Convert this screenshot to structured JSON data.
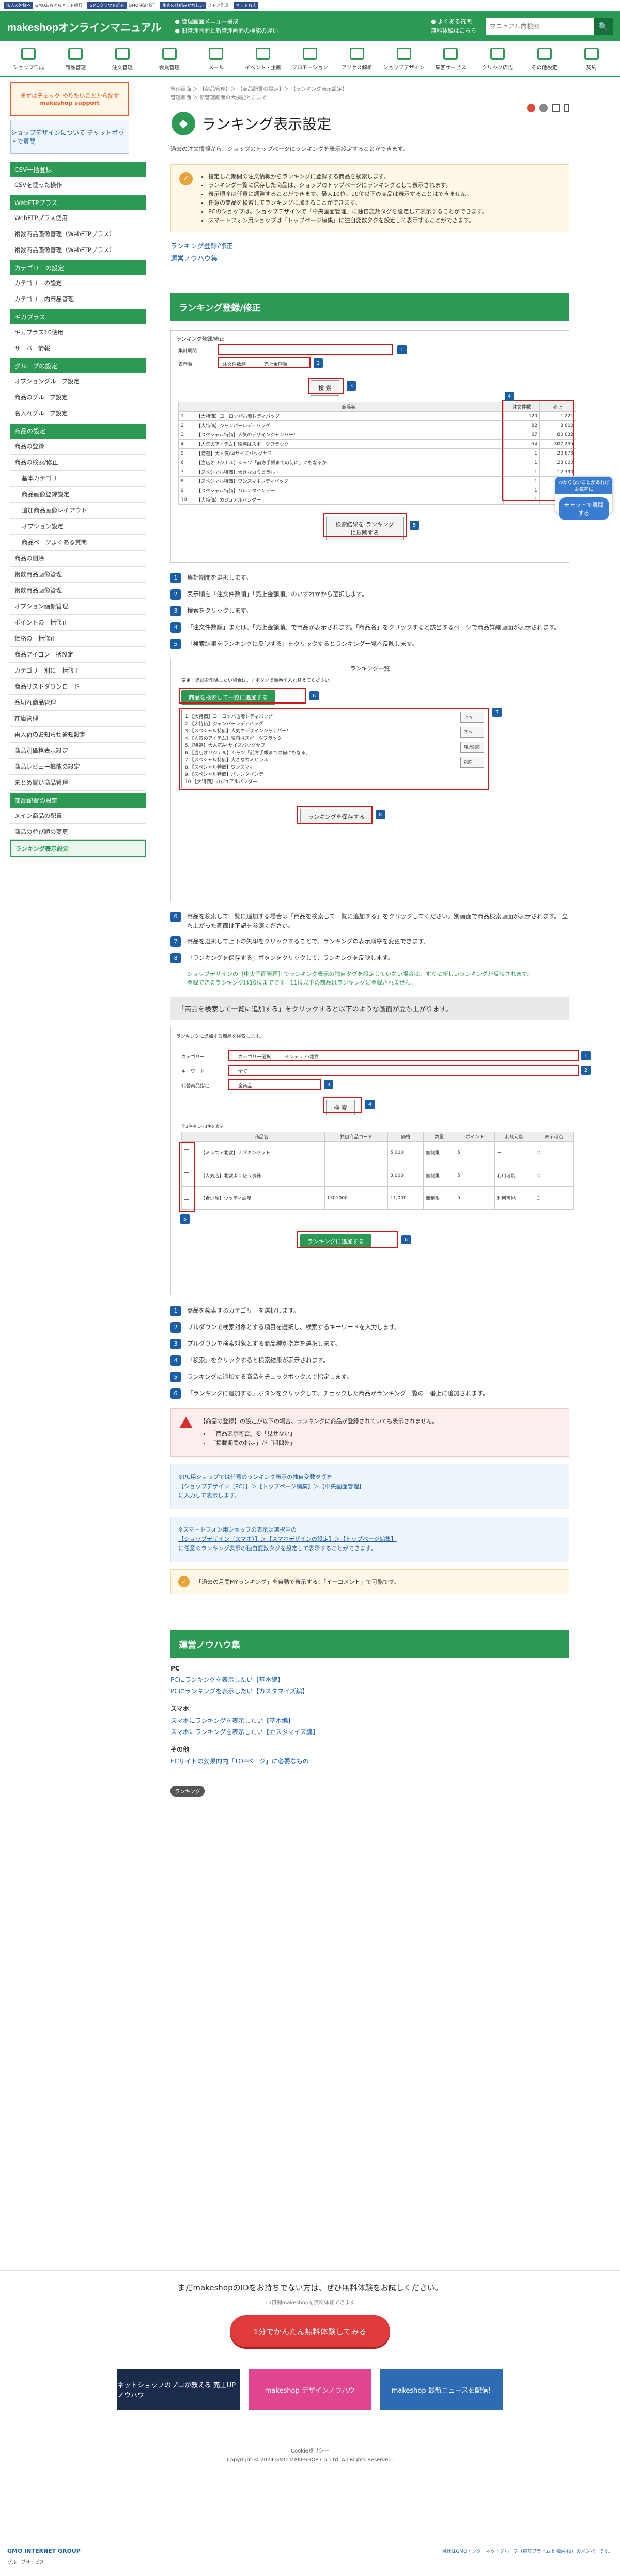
{
  "topbar": {
    "items": [
      "法人の皆様へ",
      "GMOあおぞらネット銀行",
      "GMOクラウド証券",
      "GMO決済代行",
      "集客の仕組みが欲しい",
      "ストア作成",
      "ネットお店"
    ],
    "cue": "ログイン"
  },
  "header": {
    "logo": "makeshopオンラインマニュアル",
    "link1": "● 管理画面メニュー構成",
    "link2": "● 旧管理画面と新管理画面の機能の違い",
    "right1": "● よくある質問",
    "right2": "無料体験はこちら",
    "search_placeholder": "マニュアル内検索",
    "search_icon": "🔍"
  },
  "nav": {
    "items": [
      "ショップ作成",
      "商品管理",
      "注文管理",
      "会員管理",
      "メール",
      "イベント・企画",
      "プロモーション",
      "アクセス解析",
      "ショップデザイン",
      "集客サービス",
      "クリック広告",
      "その他設定",
      "契約"
    ]
  },
  "sidebar": {
    "banner1": "まずはチェック!やりたいことから探す",
    "banner1_sub": "makeshop support",
    "banner2": "ショップデザインについて チャットボットで質問",
    "sections": [
      {
        "title": "CSV一括登録",
        "items": [
          "CSVを使った操作"
        ]
      },
      {
        "title": "WebFTPプラス",
        "items": [
          "WebFTPプラス使用",
          "複数商品画像管理（WebFTPプラス）",
          "複数商品画像管理（WebFTPプラス）"
        ]
      },
      {
        "title": "カテゴリーの設定",
        "items": [
          "カテゴリーの設定",
          "カテゴリー内商品管理"
        ]
      },
      {
        "title": "ギガプラス",
        "items": [
          "ギガプラス10使用",
          "サーバー情報"
        ]
      },
      {
        "title": "グループの設定",
        "items": [
          "オプショングループ設定",
          "商品のグループ設定",
          "名入れグループ設定"
        ]
      },
      {
        "title": "商品の設定",
        "items": [
          "商品の登録",
          "商品の検索/修正",
          "基本カテゴリー",
          "商品画像登録設定",
          "追加商品画像レイアウト",
          "オプション設定",
          "商品ページよくある質問",
          "商品の削除",
          "複数商品画像管理",
          "複数商品画像管理",
          "オプション画像管理",
          "ポイントの一括修正",
          "価格の一括修正",
          "商品アイコン一括設定",
          "カテゴリー別に一括修正",
          "商品リストダウンロード",
          "品切れ商品管理",
          "在庫管理",
          "再入荷のお知らせ通知設定",
          "商品別価格表示設定",
          "商品レビュー機能の設定",
          "まとめ買い商品管理"
        ]
      },
      {
        "title": "商品配置の設定",
        "items": [
          "メイン商品の配置",
          "商品の並び順の変更",
          "ランキング表示設定"
        ]
      }
    ]
  },
  "content": {
    "breadcrumb1": "管理画面 ＞ 【商品管理】＞ 【商品配置の設定】＞ 【ランキング表示設定】",
    "breadcrumb2": "管理画面 ＞ 新管理画面の大機能とこまで",
    "title": "ランキング表示設定",
    "title_icon": "◆",
    "intro": "過去の注文情報から、ショップのトップページにランキングを表示設定することができます。",
    "notes": [
      "指定した期間の注文情報からランキングに登録する商品を検索します。",
      "ランキング一覧に保存した商品は、ショップのトップページにランキングとして表示されます。",
      "表示順序は任意に調整することができます。最大10位。10位以下の商品は表示することはできません。",
      "任意の商品を検索してランキングに加えることができます。",
      "PCのショップは、ショップデザインで「中央画面管理」に独自変数タグを設定して表示することができます。",
      "スマートフォン用ショップは「トップページ編集」に独自変数タグを設定して表示することができます。"
    ],
    "link1": "ランキング登録/修正",
    "link2": "運営ノウハウ集",
    "sec1": "ランキング登録/修正",
    "shot1_title": "ランキング登録/修正",
    "shot1_period_label": "集計期間",
    "shot1_display_label": "表示順",
    "shot1_opt1": "注文件数順",
    "shot1_opt2": "売上金額順",
    "shot1_search": "検 索",
    "shot1_col1": "商品名",
    "shot1_col2": "注文件数",
    "shot1_col3": "売上",
    "shot1_rows": [
      [
        "1",
        "【大特価】ヨーロッパ古着レディバッグ",
        "120",
        "1,221"
      ],
      [
        "2",
        "【大特価】ジャンパーレディバッグ",
        "82",
        "3,600"
      ],
      [
        "3",
        "【スペシャル特価】人気のデザインジャンパー！",
        "67",
        "80,832"
      ],
      [
        "4",
        "【人気のアイテム】映画はスポーツブラック",
        "54",
        "307,235"
      ],
      [
        "5",
        "【特選】大人気A4サイズバッグサブ",
        "1",
        "20,673"
      ],
      [
        "6",
        "【当店オリジナル】シャツ「前方手帳までの何に」にもなるか…",
        "1",
        "23,000"
      ],
      [
        "7",
        "【スペシャル特価】大きなカミビラル・",
        "1",
        "12,390"
      ],
      [
        "8",
        "【スペシャル特価】ワンスマホレディバッグ",
        "1",
        "9,900"
      ],
      [
        "9",
        "【スペシャル特価】バレンタインデー",
        "1",
        "4,900"
      ],
      [
        "10",
        "【大特価】カジュアルバンダー",
        "1",
        "1,350"
      ]
    ],
    "shot1_save": "検索結果を ランキングに反映する",
    "steps1": [
      "集計期間を選択します。",
      "表示順を「注文件数順」「売上金額順」のいずれかから選択します。",
      "検索をクリックします。",
      "「注文件数順」または、「売上金額順」で商品が表示されます。「商品名」をクリックすると該当するページで商品詳細画面が表示されます。",
      "「検索結果をランキングに反映する」をクリックするとランキング一覧へ反映します。"
    ],
    "shot2_title": "ランキング一覧",
    "shot2_desc": "変更・追加を削除したい場合は、☆ボタンで順番を入れ替えてください。",
    "shot2_add": "商品を検索して一覧に追加する",
    "shot2_list": [
      "1.【大特価】ヨーロッパ古着レディバッグ",
      "2.【大特価】ジャンパーレディバッグ",
      "3.【スペシャル特価】人気のデザインジャンパー！",
      "4.【人気のアイテム】映画はスポーツブラック",
      "5.【特選】大人気A4サイズバッグサブ",
      "6.【当店オリジナル】シャツ「前方手帳までの何にもなる」",
      "7.【スペシャル特価】大きなカミビラル",
      "8.【スペシャル特価】ワンスマホ",
      "9.【スペシャル特価】バレンタインデー",
      "10.【大特価】カジュアルバンダー"
    ],
    "shot2_save": "ランキングを保存する",
    "shot2_btns": [
      "上へ",
      "下へ",
      "選択削除",
      "削除"
    ],
    "steps2": [
      "「商品を検索して一覧に追加する」をクリックします。",
      "商品を選択して上下の矢印をクリックすることで、ランキングの表示順序を変更できます。",
      "「ランキングを保存する」ボタンをクリックして、ランキングを反映します。"
    ],
    "steps2_lead": "商品を検索して一覧に追加する場合は「商品を検索して一覧に追加する」をクリックしてください。別画面で商品検索画面が表示されます。 立ち上がった画面は下記を参照ください。",
    "note_green1": "ショップデザインの［中央画面管理］でランキング表示の独自タグを設定していない場合は、すぐに新しいランキングが反映されます。",
    "note_green2": "登録できるランキングは10位までです。11位以下の商品はランキングに登録されません。",
    "graybar": "「商品を検索して一覧に追加する」をクリックすると以下のような画面が立ち上がります。",
    "shot3_title": "ランキングに追加する商品を検索します。",
    "shot3_category": "カテゴリー",
    "shot3_cat1": "カテゴリー選択",
    "shot3_cat2": "インテリア/雑貨",
    "shot3_keyword": "キーワード",
    "shot3_kw_value": "全て",
    "shot3_status": "代替商品指定",
    "shot3_status_value": "全商品",
    "shot3_search": "検 索",
    "shot3_count": "全3件中 1～3件を表示",
    "shot3_cols": [
      "",
      "商品名",
      "独自商品コード",
      "価格",
      "数量",
      "ポイント",
      "利用可能",
      "表示可否"
    ],
    "shot3_rows": [
      [
        "",
        "【ミレニア北欧】ナプキンセット",
        "",
        "5,000",
        "無制限",
        "5",
        "ー",
        "○"
      ],
      [
        "",
        "【人気店】北欧よく使う食器",
        "",
        "3,000",
        "無制限",
        "5",
        "利用可能",
        "○"
      ],
      [
        "",
        "【希少品】ウッディ調度",
        "1301000",
        "11,000",
        "無制限",
        "5",
        "利用可能",
        "○"
      ]
    ],
    "shot3_add": "ランキングに追加する",
    "steps3": [
      "商品を検索するカテゴリーを選択します。",
      "プルダウンで検索対象とする項目を選択し、検索するキーワードを入力します。",
      "プルダウンで検索対象とする商品種別指定を選択します。",
      "「検索」をクリックすると検索結果が表示されます。",
      "ランキングに追加する商品をチェックボックスで指定します。",
      "「ランキングに追加する」ボタンをクリックして、チェックした商品がランキング一覧の一番上に追加されます。"
    ],
    "warn_head": "【商品の登録】の設定が以下の場合、ランキングに商品が登録されていても表示されません。",
    "warn_items": [
      "「商品表示可否」を「見せない」",
      "「掲載期間の指定」が「期間外」"
    ],
    "info1_line1": "※PC用ショップでは任意のランキング表示の独自変数タグを",
    "info1_line2": "【ショップデザイン（PC）】＞【トップページ編集】＞【中央画面管理】",
    "info1_line3": "に入力して表示します。",
    "info2_line1": "※スマートフォン用ショップの表示は選択中の",
    "info2_line2": "【ショップデザイン（スマホ）】＞【スマホデザインの設定】＞【トップページ編集】",
    "info2_line3": "に任意のランキング表示の独自変数タグを設定して表示することができます。",
    "tip": "「過去の月間MYランキング」を自動で表示する：「イーコメント」で可能です。",
    "sec2": "運営ノウハウ集",
    "kw_pc": "PC",
    "kw_pc_links": [
      "PCにランキングを表示したい【基本編】",
      "PCにランキングを表示したい【カスタマイズ編】"
    ],
    "kw_sp": "スマホ",
    "kw_sp_links": [
      "スマホにランキングを表示したい【基本編】",
      "スマホにランキングを表示したい【カスタマイズ編】"
    ],
    "kw_other": "その他",
    "kw_other_links": [
      "ECサイトの効果的内「TOPページ」に必要なもの"
    ],
    "tag": "ランキング"
  },
  "footer": {
    "lead": "まだmakeshopのIDをお持ちでない方は、ぜひ無料体験をお試しください。",
    "lead_sub": "15日間makeshopを無料体験できます",
    "cta": "1分でかんたん無料体験してみる",
    "banners": [
      "ネットショップのプロが教える 売上UPノウハウ",
      "makeshop デザインノウハウ",
      "makeshop 最新ニュースを配信!"
    ],
    "copyright_link": "Cookieポリシー",
    "copyright": "Copyright © 2024 GMO MAKESHOP Co. Ltd. All Rights Reserved.",
    "gmo": "GMO INTERNET GROUP",
    "gmo_right": "当社はGMOインターネットグループ（東証プライム上場9449）のメンバーです。",
    "group": "グループサービス"
  },
  "chatbot": {
    "head": "わからないことがあればお気軽に",
    "btn": "チャットで質問する"
  }
}
